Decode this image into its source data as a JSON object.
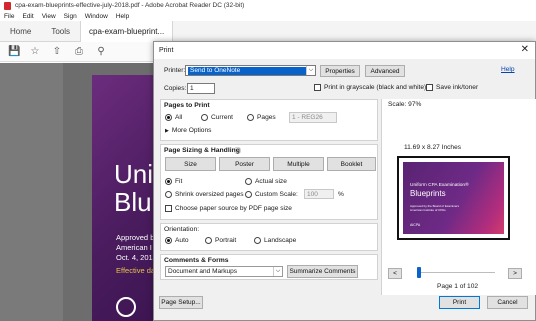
{
  "app": {
    "title": "cpa-exam-blueprints-effective-july-2018.pdf - Adobe Acrobat Reader DC (32-bit)",
    "menu": [
      "File",
      "Edit",
      "View",
      "Sign",
      "Window",
      "Help"
    ],
    "tabs": {
      "home": "Home",
      "tools": "Tools",
      "document": "cpa-exam-blueprint..."
    }
  },
  "cover": {
    "line1": "Unif",
    "line2": "Blu",
    "sub1": "Approved b",
    "sub2": "American I",
    "sub3": "Oct. 4, 2018",
    "sub4": "Effective da"
  },
  "dialog": {
    "title": "Print",
    "help_link": "Help",
    "printer_label": "Printer:",
    "printer_value": "Send to OneNote",
    "properties_button": "Properties",
    "advanced_button": "Advanced",
    "copies_label": "Copies:",
    "copies_value": "1",
    "grayscale_label": "Print in grayscale (black and white)",
    "save_ink_label": "Save ink/toner",
    "pages_to_print": {
      "title": "Pages to Print",
      "all": "All",
      "current": "Current",
      "pages": "Pages",
      "pages_range": "1 - REG26",
      "more_options": "More Options"
    },
    "sizing": {
      "title": "Page Sizing & Handling",
      "size": "Size",
      "poster": "Poster",
      "multiple": "Multiple",
      "booklet": "Booklet",
      "fit": "Fit",
      "actual_size": "Actual size",
      "shrink": "Shrink oversized pages",
      "custom_scale": "Custom Scale:",
      "custom_scale_value": "100",
      "percent": "%",
      "choose_paper": "Choose paper source by PDF page size"
    },
    "orientation": {
      "title": "Orientation:",
      "auto": "Auto",
      "portrait": "Portrait",
      "landscape": "Landscape"
    },
    "comments": {
      "title": "Comments & Forms",
      "value": "Document and Markups",
      "summarize_button": "Summarize Comments"
    },
    "preview": {
      "scale": "Scale:  97%",
      "dimensions": "11.69 x 8.27 Inches",
      "thumb_line1": "Uniform CPA Examination®",
      "thumb_line2": "Blueprints",
      "thumb_line3": "Approved by the Board of Examiners",
      "thumb_line4": "American Institute of CPAs",
      "thumb_logo": "AICPA",
      "prev_button": "<",
      "next_button": ">",
      "page_info": "Page 1 of 102"
    },
    "page_setup_button": "Page Setup...",
    "print_button": "Print",
    "cancel_button": "Cancel"
  }
}
